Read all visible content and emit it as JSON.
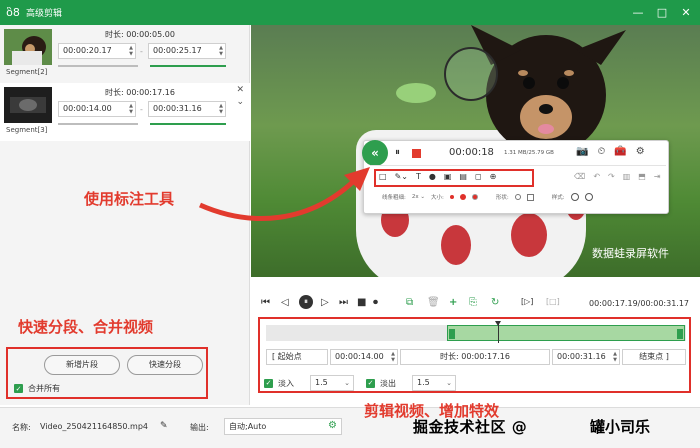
{
  "window": {
    "title": "高级剪辑",
    "logo_icon": "frog-logo",
    "controls": [
      "—",
      "□",
      "✕"
    ]
  },
  "segments": [
    {
      "label": "Segment[2]",
      "duration_label": "时长:",
      "duration": "00:00:05.00",
      "start": "00:00:20.17",
      "end": "00:00:25.17"
    },
    {
      "label": "Segment[3]",
      "duration_label": "时长:",
      "duration": "00:00:17.16",
      "start": "00:00:14.00",
      "end": "00:00:31.16"
    }
  ],
  "left_panel": {
    "note": "快速分段、合并视频",
    "new_segment": "新增片段",
    "quick_split": "快速分段",
    "merge_all": "合并所有"
  },
  "preview": {
    "watermark": "数据蛙录屏软件"
  },
  "floatbar": {
    "collapse_icon": "«",
    "pause_icon": "⏸",
    "time": "00:00:18",
    "size": "1.31 MB/25.79 GB",
    "top_icons": [
      "📷",
      "⏲",
      "🧰",
      "⚙"
    ],
    "tools": [
      "□",
      "✎⌄",
      "T",
      "●",
      "▣",
      "▤",
      "◻",
      "⊕"
    ],
    "right_tools": [
      "⌫",
      "↶",
      "↷",
      "▥",
      "⬒",
      "⇥"
    ],
    "props_size_label": "线条粗细:",
    "props_size_value": "2x ⌄",
    "props_big_label": "大小:",
    "props_color_label": "",
    "props_shape_label": "形状:",
    "props_style_label": "样式:",
    "color_red": "#e0302a",
    "color_accent": "#2e9e4e"
  },
  "annotation_note": "使用标注工具",
  "controls": {
    "icons": [
      "⏮",
      "◁",
      "⏸",
      "▷",
      "⏭",
      "■",
      "⏺",
      "⧉",
      "🗑",
      "+",
      "⎘",
      "↻",
      "[▷]",
      "[□]"
    ],
    "timecode": "00:00:17.19/00:00:31.17"
  },
  "edit": {
    "start_btn": "[   起始点",
    "start_time": "00:00:14.00",
    "duration_label": "时长:",
    "duration": "00:00:17.16",
    "end_time": "00:00:31.16",
    "end_btn": "结束点   ]",
    "fade_in": "淡入",
    "fade_in_value": "1.5",
    "fade_out": "淡出",
    "fade_out_value": "1.5"
  },
  "edit_note": "剪辑视频、增加特效",
  "bottom": {
    "name_label": "名称:",
    "name_value": "Video_250421164850.mp4",
    "output_label": "输出:",
    "output_value": "自动;Auto",
    "credit": "掘金技术社区 @",
    "credit2": "罐小司乐"
  }
}
